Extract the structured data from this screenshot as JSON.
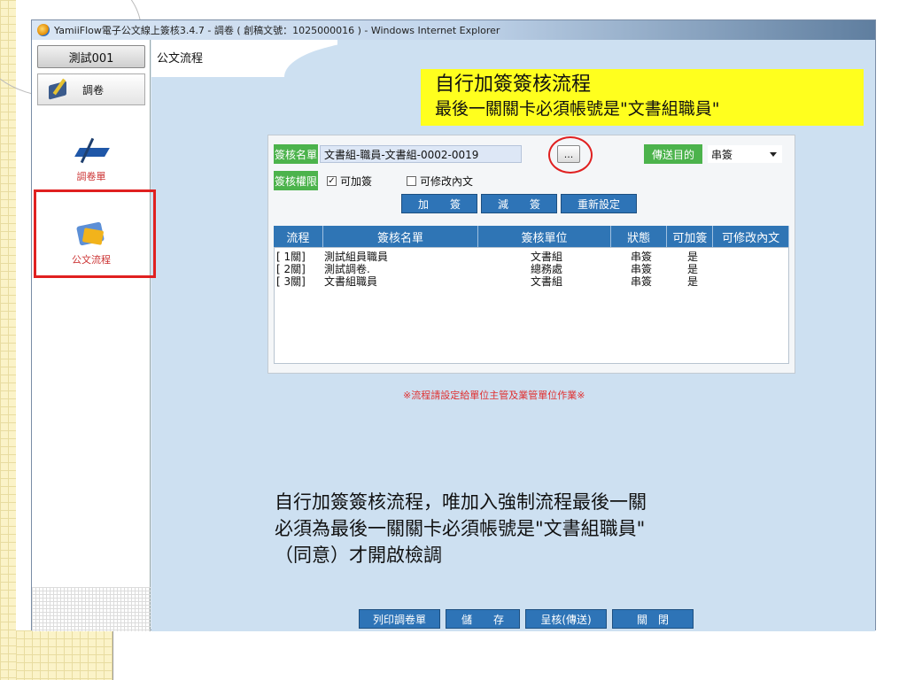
{
  "window": {
    "title": "YamiiFlow電子公文線上簽核3.4.7 - 調卷 ( 創稿文號：1025000016 ) - Windows Internet Explorer"
  },
  "left": {
    "user": "測試001",
    "nav_tab": "調卷",
    "tools": [
      {
        "label": "調卷單"
      },
      {
        "label": "公文流程"
      }
    ]
  },
  "main": {
    "title": "公文流程"
  },
  "annotation": {
    "line1": "自行加簽簽核流程",
    "line2": "最後一關關卡必須帳號是\"文書組職員\""
  },
  "form": {
    "name_label": "簽核名單",
    "name_value": "文書組-職員-文書組-0002-0019",
    "ellipsis": "...",
    "purpose_label": "傳送目的",
    "purpose_value": "串簽",
    "perm_label": "簽核權限",
    "check_add": "可加簽",
    "check_edit": "可修改內文",
    "btn_add": "加　　簽",
    "btn_remove": "減　　簽",
    "btn_reset": "重新設定"
  },
  "table": {
    "headers": [
      "流程",
      "簽核名單",
      "簽核單位",
      "狀態",
      "可加簽",
      "可修改內文"
    ],
    "rows": [
      {
        "step": "[ 1關]",
        "name": "測試組員職員",
        "unit": "文書組",
        "status": "串簽",
        "can_add": "是"
      },
      {
        "step": "[ 2關]",
        "name": "測試調卷.",
        "unit": "總務處",
        "status": "串簽",
        "can_add": "是"
      },
      {
        "step": "[ 3關]",
        "name": "文書組職員",
        "unit": "文書組",
        "status": "串簽",
        "can_add": "是"
      }
    ]
  },
  "notice": "※流程請設定給單位主管及業管單位作業※",
  "caption": {
    "line1": "自行加簽簽核流程，唯加入強制流程最後一關",
    "line2": "必須為最後一關關卡必須帳號是\"文書組職員\"",
    "line3": "（同意）才開啟檢調"
  },
  "footer": {
    "print": "列印調卷單",
    "save": "儲　　存",
    "submit": "呈核(傳送)",
    "close": "關　閉"
  },
  "colors": {
    "green_label": "#4cb34c",
    "blue_button": "#2e74b7",
    "highlight": "#ffff1e",
    "red_mark": "#e02020"
  }
}
